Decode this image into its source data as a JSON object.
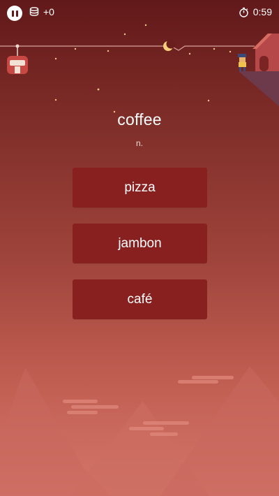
{
  "hud": {
    "coins_value": "+0",
    "timer_value": "0:59",
    "icons": [
      "pause-icon",
      "coin-stack-icon",
      "stopwatch-icon"
    ]
  },
  "question": {
    "word": "coffee",
    "part_of_speech": "n."
  },
  "options": [
    {
      "label": "pizza"
    },
    {
      "label": "jambon"
    },
    {
      "label": "café"
    }
  ],
  "colors": {
    "option_bg": "#87201f",
    "bg_top": "#62191a",
    "bg_bottom": "#d4766a"
  }
}
